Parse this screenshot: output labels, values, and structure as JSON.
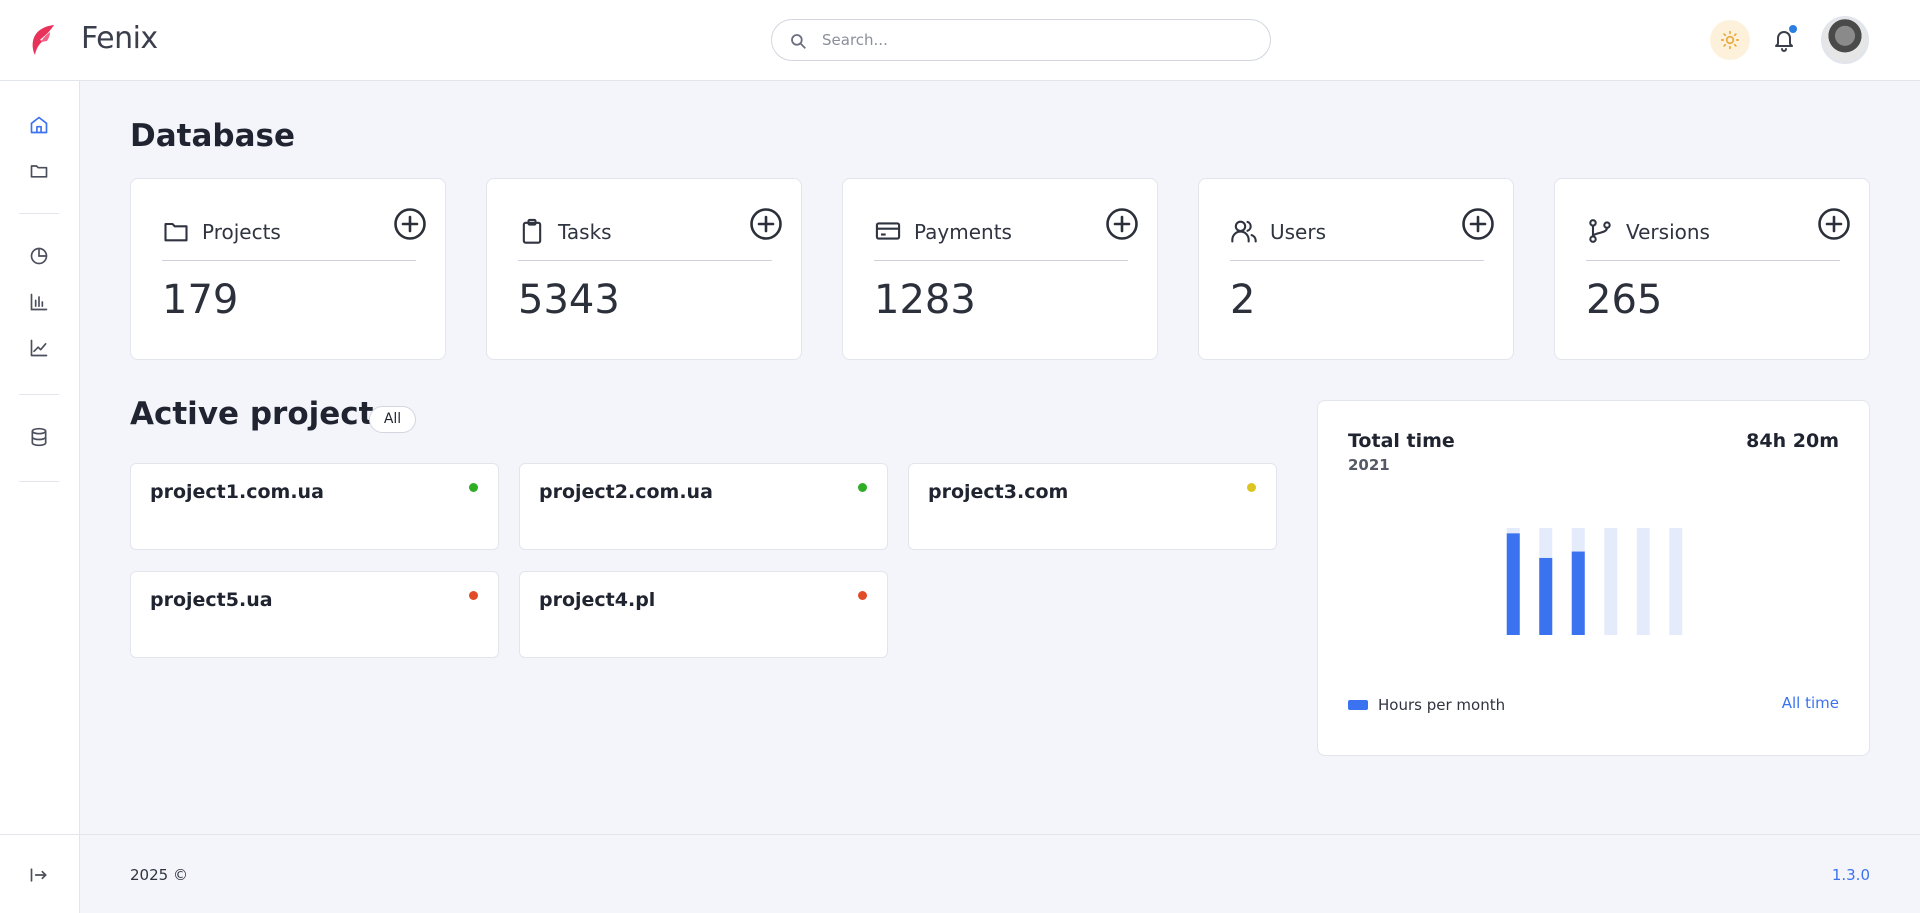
{
  "header": {
    "brand": "Fenix",
    "search_placeholder": "Search...",
    "notification_has_unread": true
  },
  "main": {
    "title": "Database",
    "stats": [
      {
        "label": "Projects",
        "value": "179",
        "icon": "folder-icon"
      },
      {
        "label": "Tasks",
        "value": "5343",
        "icon": "clipboard-icon"
      },
      {
        "label": "Payments",
        "value": "1283",
        "icon": "credit-card-icon"
      },
      {
        "label": "Users",
        "value": "2",
        "icon": "users-icon"
      },
      {
        "label": "Versions",
        "value": "265",
        "icon": "git-branch-icon"
      }
    ],
    "active_projects": {
      "title": "Active projects",
      "filter_label": "All",
      "projects": [
        {
          "name": "project1.com.ua",
          "status_color": "#2eae24"
        },
        {
          "name": "project2.com.ua",
          "status_color": "#2eae24"
        },
        {
          "name": "project3.com",
          "status_color": "#dcc522"
        },
        {
          "name": "project5.ua",
          "status_color": "#e24a28"
        },
        {
          "name": "project4.pl",
          "status_color": "#e24a28"
        }
      ]
    },
    "total_time": {
      "title": "Total time",
      "year": "2021",
      "total": "84h 20m",
      "legend": "Hours per month",
      "link": "All time"
    }
  },
  "chart_data": {
    "type": "bar",
    "categories": [
      "",
      "",
      "",
      "",
      "",
      ""
    ],
    "series": [
      {
        "name": "Hours per month",
        "values": [
          0.95,
          0.72,
          0.78,
          0,
          0,
          0
        ]
      }
    ],
    "ylim": [
      0,
      1
    ],
    "grid": false
  },
  "colors": {
    "accent": "#3b72f0",
    "bar_track": "#e4ecfb",
    "brand_logo": "#e8325a"
  },
  "footer": {
    "copyright": "2025 ©",
    "version": "1.3.0"
  }
}
